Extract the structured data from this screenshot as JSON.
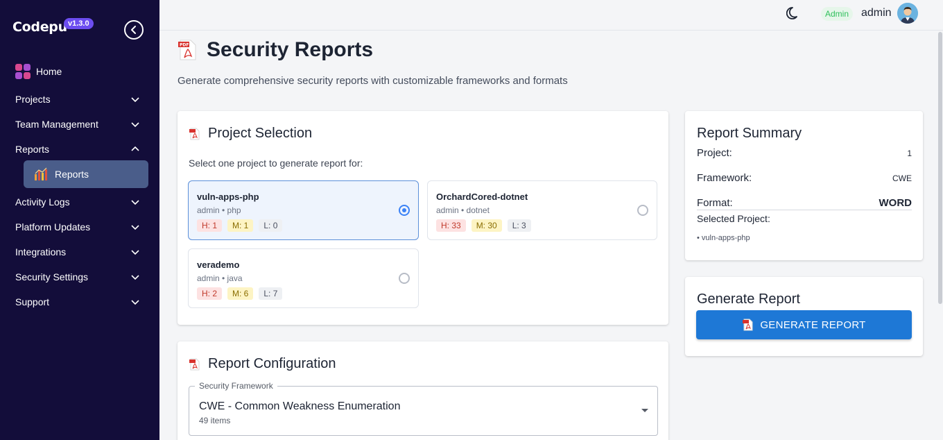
{
  "app": {
    "logo_text": "Codepu",
    "version": "v1.3.0"
  },
  "sidebar": {
    "home_label": "Home",
    "items": [
      {
        "label": "Projects"
      },
      {
        "label": "Team Management"
      },
      {
        "label": "Reports"
      },
      {
        "label": "Activity Logs"
      },
      {
        "label": "Platform Updates"
      },
      {
        "label": "Integrations"
      },
      {
        "label": "Security Settings"
      },
      {
        "label": "Support"
      }
    ],
    "active_sub": "Reports"
  },
  "header": {
    "role": "Admin",
    "username": "admin"
  },
  "page": {
    "title": "Security Reports",
    "subtitle": "Generate comprehensive security reports with customizable frameworks and formats"
  },
  "project_selection": {
    "title": "Project Selection",
    "prompt": "Select one project to generate report for:",
    "projects": [
      {
        "name": "vuln-apps-php",
        "meta": "admin • php",
        "h": "H: 1",
        "m": "M: 1",
        "l": "L: 0",
        "selected": true
      },
      {
        "name": "OrchardCored-dotnet",
        "meta": "admin • dotnet",
        "h": "H: 33",
        "m": "M: 30",
        "l": "L: 3",
        "selected": false
      },
      {
        "name": "verademo",
        "meta": "admin • java",
        "h": "H: 2",
        "m": "M: 6",
        "l": "L: 7",
        "selected": false
      }
    ]
  },
  "report_config": {
    "title": "Report Configuration",
    "framework_label": "Security Framework",
    "framework_value": "CWE - Common Weakness Enumeration",
    "framework_sub": "49 items"
  },
  "summary": {
    "title": "Report Summary",
    "project_label": "Project:",
    "project_value": "1",
    "framework_label": "Framework:",
    "framework_value": "CWE",
    "format_label": "Format:",
    "format_value": "WORD",
    "selected_label": "Selected Project:",
    "selected_value": "• vuln-apps-php"
  },
  "generate": {
    "title": "Generate Report",
    "button_label": "GENERATE REPORT"
  },
  "colors": {
    "sidebar_bg": "#130d3a",
    "accent": "#1e78d6",
    "active_nav": "#4a5d8a",
    "version_badge": "#6c4df0"
  }
}
